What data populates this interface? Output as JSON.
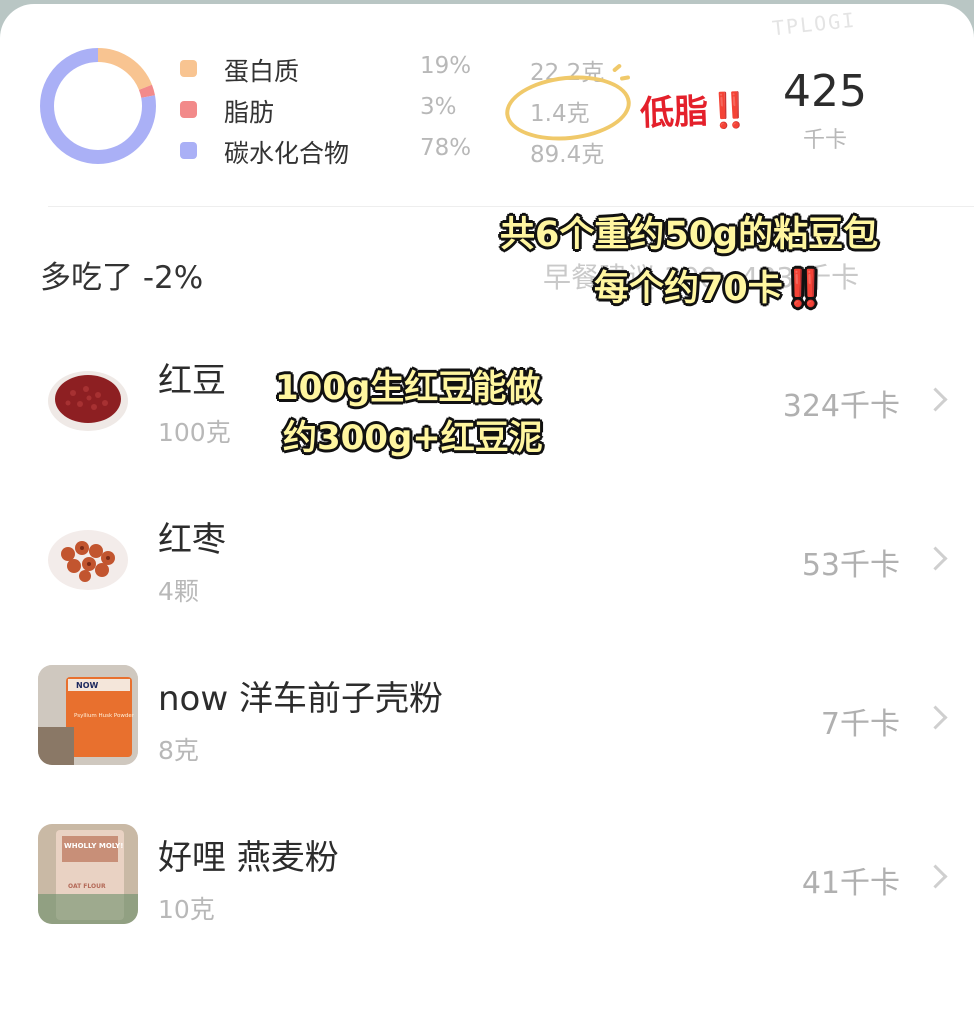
{
  "watermark": "TPLOGI",
  "macros": [
    {
      "name": "蛋白质",
      "percent": "19%",
      "grams": "22.2克",
      "color": "#f8c491"
    },
    {
      "name": "脂肪",
      "percent": "3%",
      "grams": "1.4克",
      "color": "#f28a8a"
    },
    {
      "name": "碳水化合物",
      "percent": "78%",
      "grams": "89.4克",
      "color": "#aab0f6"
    }
  ],
  "donut_fractions": {
    "protein": 0.19,
    "fat": 0.03,
    "carbs": 0.78
  },
  "total": {
    "value": "425",
    "unit": "千卡"
  },
  "summary": {
    "over_text": "多吃了 -2%",
    "suggest_text": "早餐建议 300~433 千卡"
  },
  "foods": [
    {
      "name": "红豆",
      "qty": "100克",
      "kcal": "324千卡",
      "icon": "red-bean-image"
    },
    {
      "name": "红枣",
      "qty": "4颗",
      "kcal": "53千卡",
      "icon": "red-date-image"
    },
    {
      "name": "now 洋车前子壳粉",
      "qty": "8克",
      "kcal": "7千卡",
      "icon": "psyllium-powder-image"
    },
    {
      "name": "好哩 燕麦粉",
      "qty": "10克",
      "kcal": "41千卡",
      "icon": "oat-flour-image"
    }
  ],
  "annotations": {
    "low_fat": "低脂‼️",
    "bun_line1": "共6个重约50g的粘豆包",
    "bun_line2": "每个约70卡",
    "bun_line2_mark": "‼️",
    "bean_line1": "100g生红豆能做",
    "bean_line2": "约300g+红豆泥"
  },
  "product_labels": {
    "now_brand": "NOW",
    "psyllium": "Psyllium Husk Powder",
    "wholly": "WHOLLY MOLY!",
    "oat": "OAT FLOUR"
  }
}
